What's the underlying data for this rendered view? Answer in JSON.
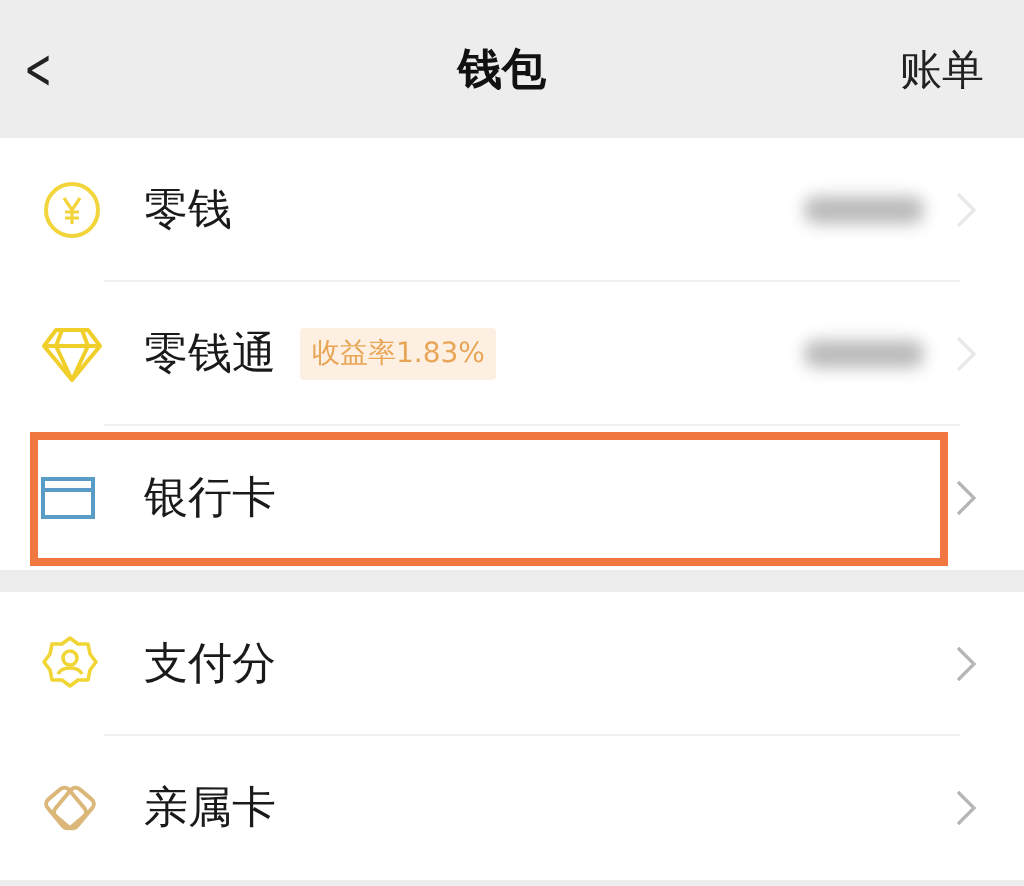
{
  "header": {
    "back": "<",
    "title": "钱包",
    "action": "账单"
  },
  "sections": [
    {
      "items": [
        {
          "label": "零钱",
          "amount_hidden": true,
          "highlighted": false
        },
        {
          "label": "零钱通",
          "badge": "收益率1.83%",
          "amount_hidden": true,
          "highlighted": false
        },
        {
          "label": "银行卡",
          "amount_hidden": false,
          "highlighted": true
        }
      ]
    },
    {
      "items": [
        {
          "label": "支付分",
          "amount_hidden": false,
          "highlighted": false
        },
        {
          "label": "亲属卡",
          "amount_hidden": false,
          "highlighted": false
        }
      ]
    }
  ]
}
